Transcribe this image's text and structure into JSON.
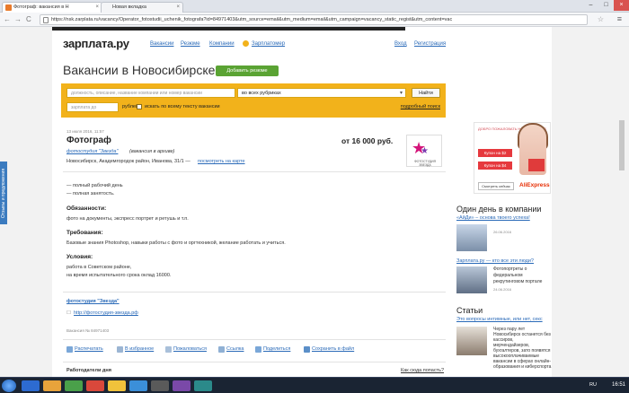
{
  "browser": {
    "tab1_title": "Фотограф: вакансия в Н",
    "tab2_title": "Новая вкладка",
    "url": "https://nsk.zarplata.ru/vacancy/Operator_fotostudii_uchenik_fotografa?id=84971403&utm_source=email&utm_medium=email&utm_campaign=vacancy_static_regist&utm_content=vac",
    "back": "←",
    "forward": "→",
    "reload": "C"
  },
  "feedback_tab": "Отзывы и предложения",
  "header": {
    "logo": "зарплата.ру",
    "nav": [
      "Вакансии",
      "Резюме",
      "Компании",
      "Зарплатомер"
    ],
    "login": "Вход",
    "register": "Регистрация"
  },
  "page_title": "Вакансии в Новосибирске",
  "add_resume": "Добавить резюме",
  "search": {
    "placeholder": "должность, описание, название компании или номер вакансии",
    "rubric": "во всех рубриках",
    "button": "Найти",
    "salary_placeholder": "зарплата до",
    "currency": "рублей",
    "fulltext_label": "искать по всему тексту вакансии",
    "advanced": "подробный поиск"
  },
  "vacancy": {
    "date": "13 июля 2016, 11:57",
    "title": "Фотограф",
    "salary": "от 16 000 руб.",
    "company": "фотостудия \"Звезда\"",
    "archive": "(вакансия в архиве)",
    "address": "Новосибирск, Академгородок район, Иванова, 31/1 —",
    "map_link": "посмотреть на карте",
    "logo_text": "ФОТОСТУДИЯ ЗВЕЗДА",
    "conditions": [
      "— полный рабочий день",
      "— полная занятость."
    ],
    "duties_title": "Обязанности:",
    "duties": "фото на документы, экспресс портрет и ретушь и т.п.",
    "req_title": "Требования:",
    "req": "Базовые знания Photoshop, навыки работы с фото и оргтехникой, желание работать и учиться.",
    "cond_title": "Условия:",
    "cond_lines": [
      "работа в Советском районе,",
      "на время испытательного срока оклад 16000."
    ],
    "company_link": "фотостудия \"Звезда\"",
    "site": "http://фотостудия-звезда.рф",
    "number": "Вакансия № 84971403"
  },
  "actions": [
    "Распечатать",
    "В избранное",
    "Пожаловаться",
    "Ссылка",
    "Поделиться",
    "Сохранить в файл"
  ],
  "footer_left": "Работодатели дня",
  "footer_right": "Как сюда попасть?",
  "ad": {
    "top": "ДОБРО ПОЖАЛОВАТЬ НА ALIEXPRESS",
    "coupon1": "Купон на $2",
    "coupon2": "Купон на $4",
    "button": "Смотреть сейчас",
    "brand": "AliExpress"
  },
  "sidebar": {
    "heading1": "Один день в компании",
    "link1": "«АйДи» – основа твоего успеха!",
    "date1": "26.06.2016",
    "link2": "Зарплата.ру — кто все эти люди?",
    "text2": [
      "Фотопортреты о",
      "федеральном",
      "рекрутинговом портале"
    ],
    "date2": "24.06.2016",
    "heading2": "Статьи",
    "link3": "Это вопросы интимные, или нет, секс",
    "text3": [
      "Через пару лет",
      "Новосибирск останется без",
      "кассиров,",
      "мерчендайзеров,",
      "бухгалтеров, зато появятся",
      "высокооплачиваемые",
      "вакансии в сферах онлайн-",
      "образования и киберспорта"
    ]
  },
  "taskbar": {
    "lang": "RU",
    "time": "16:51"
  }
}
